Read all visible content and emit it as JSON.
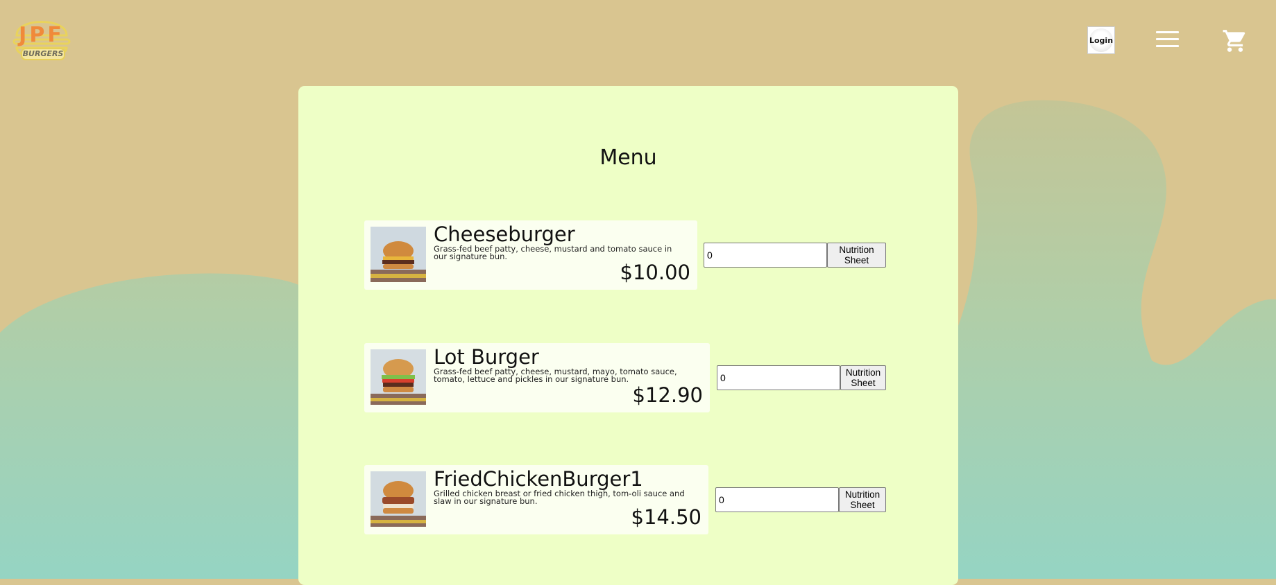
{
  "header": {
    "logo_text": "JPF",
    "logo_subtext": "BURGERS",
    "login_label": "Login",
    "menu_icon": "hamburger-menu-icon",
    "cart_icon": "shopping-cart-icon"
  },
  "main": {
    "title": "Menu",
    "items": [
      {
        "name": "Cheeseburger",
        "description": "Grass-fed beef patty, cheese, mustard and tomato sauce in our signature bun.",
        "price": "$10.00",
        "quantity": "0",
        "nutrition_label": "Nutrition Sheet"
      },
      {
        "name": "Lot Burger",
        "description": "Grass-fed beef patty, cheese, mustard, mayo, tomato sauce, tomato, lettuce and pickles in our signature bun.",
        "price": "$12.90",
        "quantity": "0",
        "nutrition_label": "Nutrition Sheet"
      },
      {
        "name": "FriedChickenBurger1",
        "description": "Grilled chicken breast or fried chicken thigh, tom-oli sauce and slaw in our signature bun.",
        "price": "$14.50",
        "quantity": "0",
        "nutrition_label": "Nutrition Sheet"
      }
    ]
  },
  "colors": {
    "background_top": "#d9c590",
    "background_bottom": "#95d4c3",
    "card": "#eeffc6",
    "item_panel": "#fbfff0",
    "logo_orange": "#f08a3a"
  }
}
